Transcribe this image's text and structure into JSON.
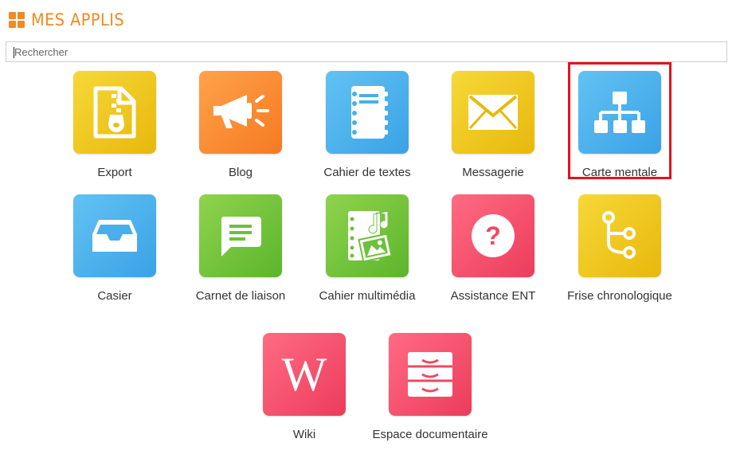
{
  "header": {
    "title": "MES APPLIS",
    "icon": "grid-icon",
    "accent": "#f08a24"
  },
  "search": {
    "placeholder": "Rechercher",
    "value": ""
  },
  "apps": [
    {
      "label": "Export",
      "icon": "zip-file-icon",
      "color": "yellow"
    },
    {
      "label": "Blog",
      "icon": "megaphone-icon",
      "color": "orange"
    },
    {
      "label": "Cahier de textes",
      "icon": "notebook-icon",
      "color": "blue"
    },
    {
      "label": "Messagerie",
      "icon": "envelope-icon",
      "color": "yellow"
    },
    {
      "label": "Carte mentale",
      "icon": "hierarchy-icon",
      "color": "blue",
      "highlighted": true
    },
    {
      "label": "Casier",
      "icon": "inbox-tray-icon",
      "color": "blue"
    },
    {
      "label": "Carnet de liaison",
      "icon": "chat-bubble-icon",
      "color": "green"
    },
    {
      "label": "Cahier multimédia",
      "icon": "media-notebook-icon",
      "color": "green"
    },
    {
      "label": "Assistance ENT",
      "icon": "question-icon",
      "color": "red"
    },
    {
      "label": "Frise chronologique",
      "icon": "timeline-branch-icon",
      "color": "yellow"
    },
    {
      "label": "Wiki",
      "icon": "wikipedia-w-icon",
      "color": "red"
    },
    {
      "label": "Espace documentaire",
      "icon": "drawers-icon",
      "color": "red"
    }
  ],
  "highlight_color": "#e3131b"
}
